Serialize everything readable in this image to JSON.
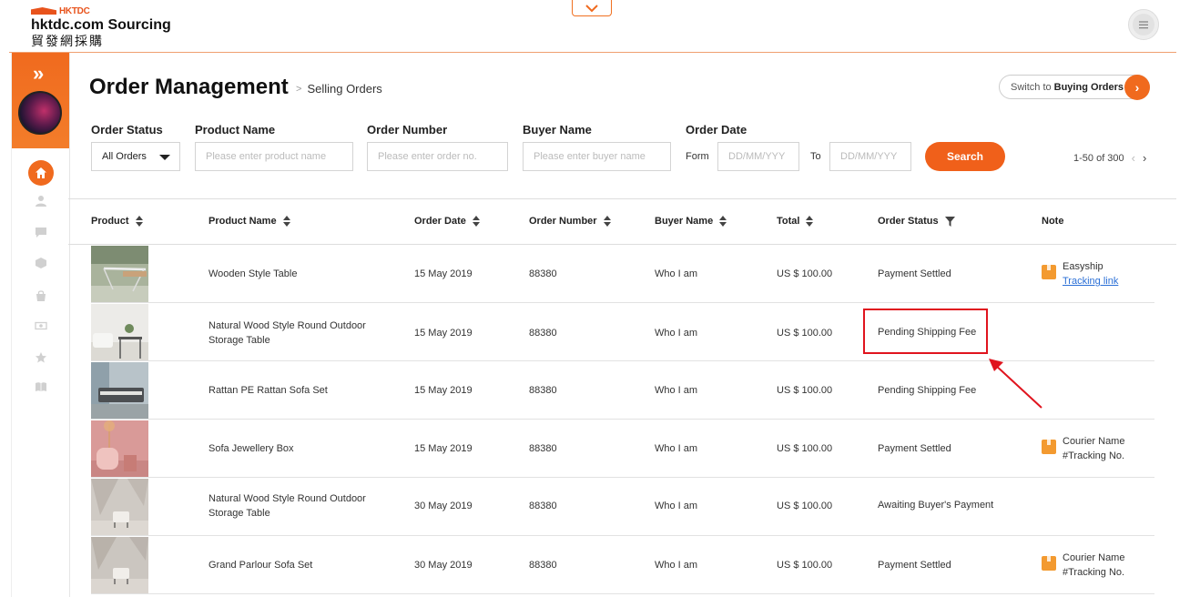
{
  "brand": {
    "hktdc": "HKTDC",
    "name": "hktdc.com Sourcing",
    "cn": "貿發網採購"
  },
  "header": {
    "menu_icon": "hamburger-icon",
    "toggle_icon": "chevron-down-icon"
  },
  "page": {
    "title": "Order Management",
    "breadcrumb": "Selling Orders",
    "switch_prefix": "Switch to",
    "switch_strong": "Buying Orders"
  },
  "filters": {
    "order_status": {
      "label": "Order Status",
      "value": "All Orders"
    },
    "product_name": {
      "label": "Product Name",
      "placeholder": "Please enter product name"
    },
    "order_number": {
      "label": "Order Number",
      "placeholder": "Please enter order no."
    },
    "buyer_name": {
      "label": "Buyer Name",
      "placeholder": "Please enter buyer name"
    },
    "order_date": {
      "label": "Order Date",
      "from_label": "Form",
      "to_label": "To",
      "from_placeholder": "DD/MM/YYY",
      "to_placeholder": "DD/MM/YYY"
    },
    "search_label": "Search"
  },
  "pagination": {
    "range": "1-50 of 300"
  },
  "table": {
    "headers": {
      "product": "Product",
      "product_name": "Product Name",
      "order_date": "Order Date",
      "order_number": "Order Number",
      "buyer_name": "Buyer Name",
      "total": "Total",
      "order_status": "Order Status",
      "note": "Note"
    },
    "rows": [
      {
        "name": "Wooden Style Table",
        "date": "15 May 2019",
        "number": "88380",
        "buyer": "Who I am",
        "total": "US $ 100.00",
        "status": "Payment Settled",
        "note1": "Easyship",
        "note2": "Tracking link"
      },
      {
        "name": "Natural Wood Style Round Outdoor Storage Table",
        "date": "15 May 2019",
        "number": "88380",
        "buyer": "Who I am",
        "total": "US $ 100.00",
        "status": "Pending Shipping Fee",
        "note1": "",
        "note2": ""
      },
      {
        "name": "Rattan PE Rattan Sofa Set",
        "date": "15 May 2019",
        "number": "88380",
        "buyer": "Who I am",
        "total": "US $ 100.00",
        "status": "Pending Shipping Fee",
        "note1": "",
        "note2": ""
      },
      {
        "name": "Sofa Jewellery Box",
        "date": "15 May 2019",
        "number": "88380",
        "buyer": "Who I am",
        "total": "US $ 100.00",
        "status": "Payment Settled",
        "note1": "Courier Name",
        "note2": "#Tracking No."
      },
      {
        "name": "Natural Wood Style Round Outdoor Storage Table",
        "date": "30 May 2019",
        "number": "88380",
        "buyer": "Who I am",
        "total": "US $ 100.00",
        "status": "Awaiting Buyer's Payment",
        "note1": "",
        "note2": ""
      },
      {
        "name": "Grand Parlour Sofa Set",
        "date": "30 May 2019",
        "number": "88380",
        "buyer": "Who I am",
        "total": "US $ 100.00",
        "status": "Payment Settled",
        "note1": "Courier Name",
        "note2": "#Tracking No."
      }
    ]
  },
  "colors": {
    "accent": "#f06a1e",
    "highlight": "#e0141e",
    "link": "#2a6fd6"
  }
}
